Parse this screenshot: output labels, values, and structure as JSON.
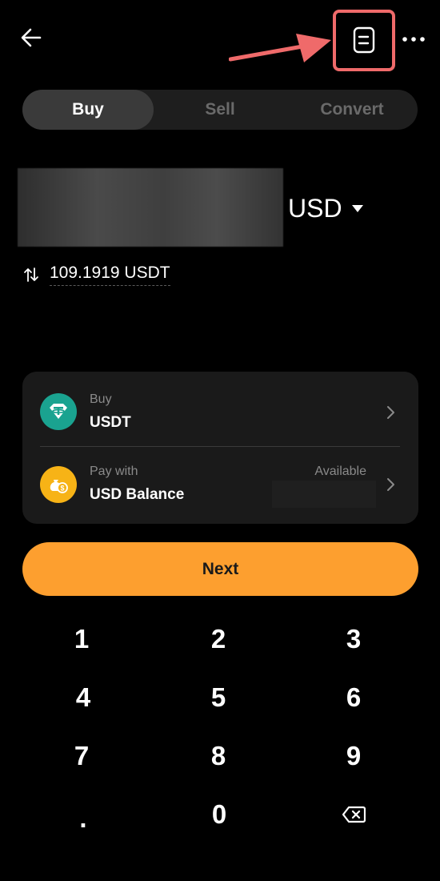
{
  "header": {
    "back_icon": "arrow-left-icon",
    "history_icon": "order-history-icon",
    "more_icon": "more-horizontal-icon",
    "highlight_color": "#ef6a6a"
  },
  "tabs": [
    {
      "label": "Buy",
      "active": true
    },
    {
      "label": "Sell",
      "active": false
    },
    {
      "label": "Convert",
      "active": false
    }
  ],
  "amount": {
    "currency": "USD",
    "converted": "109.1919 USDT"
  },
  "card": {
    "buy_label": "Buy",
    "buy_value": "USDT",
    "pay_label": "Pay with",
    "pay_value": "USD Balance",
    "available_label": "Available",
    "usdt_color": "#1aa390",
    "usd_color": "#f7b316"
  },
  "next_button": {
    "label": "Next",
    "color": "#fd9f2f"
  },
  "keypad": {
    "keys": [
      "1",
      "2",
      "3",
      "4",
      "5",
      "6",
      "7",
      "8",
      "9",
      ".",
      "0"
    ],
    "backspace_icon": "backspace-icon"
  }
}
